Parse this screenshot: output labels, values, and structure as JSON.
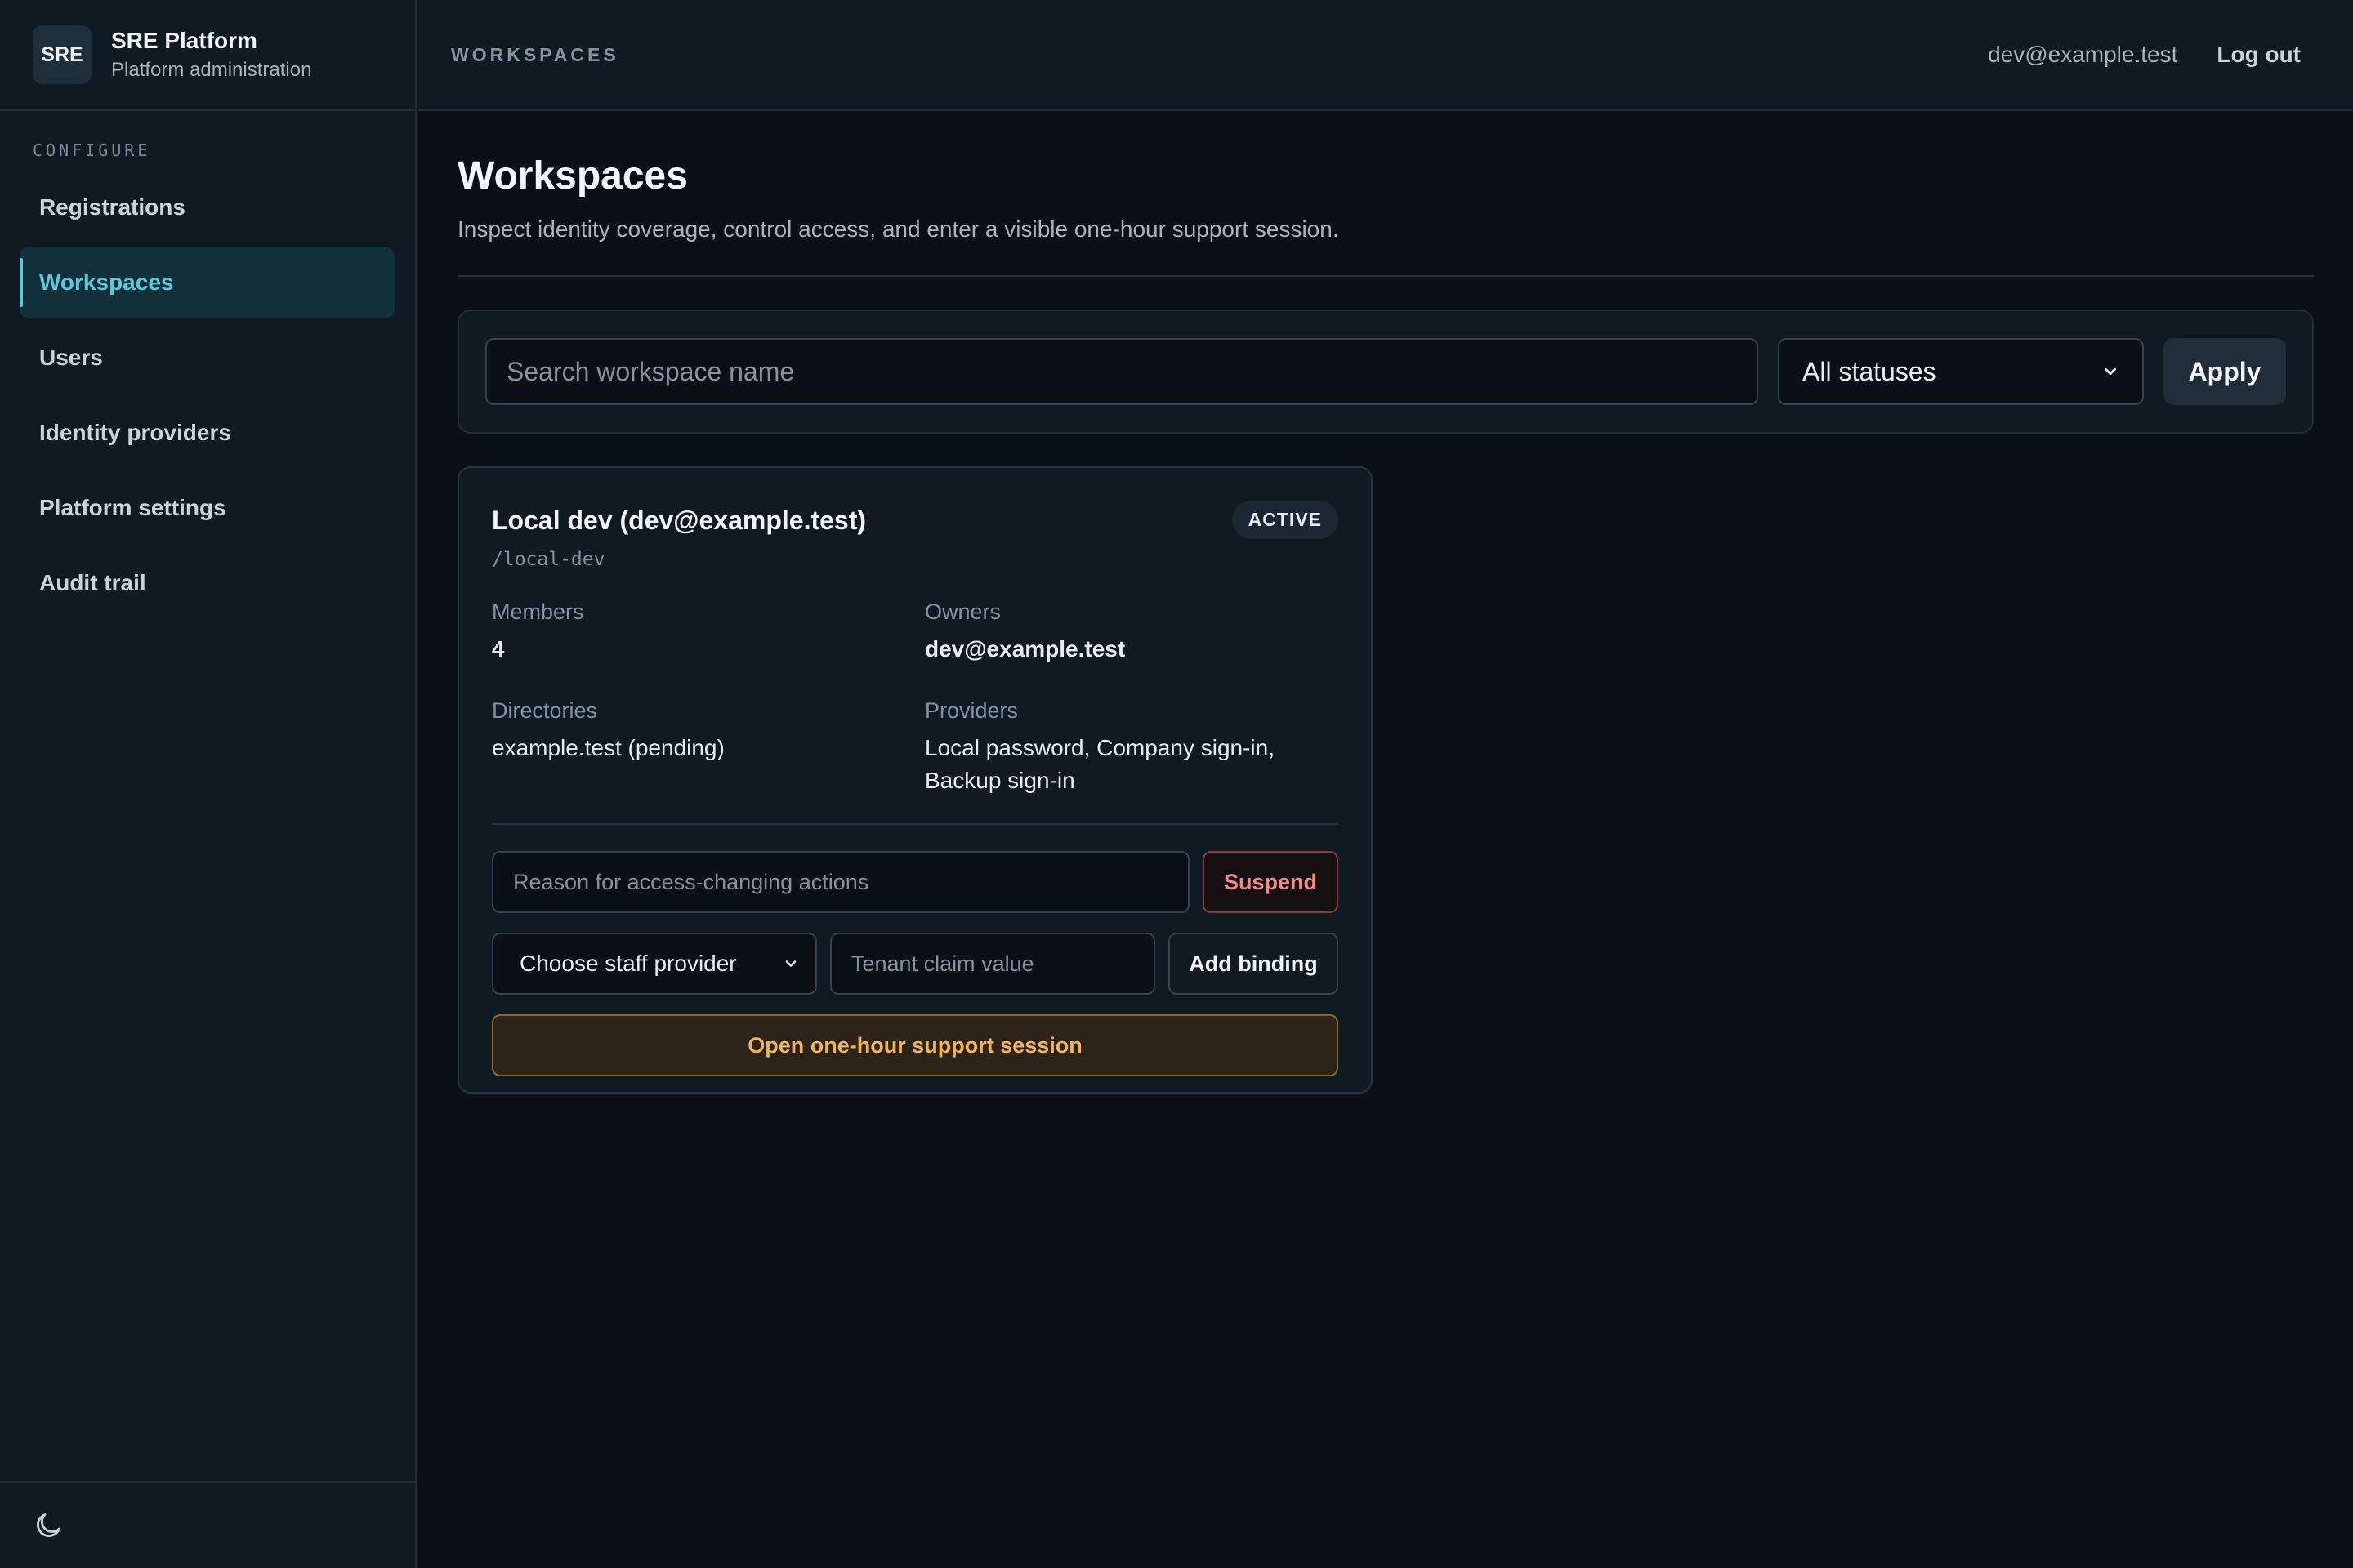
{
  "brand": {
    "logo": "SRE",
    "title": "SRE Platform",
    "subtitle": "Platform administration"
  },
  "sidebar": {
    "section": "CONFIGURE",
    "items": [
      {
        "label": "Registrations",
        "active": false
      },
      {
        "label": "Workspaces",
        "active": true
      },
      {
        "label": "Users",
        "active": false
      },
      {
        "label": "Identity providers",
        "active": false
      },
      {
        "label": "Platform settings",
        "active": false
      },
      {
        "label": "Audit trail",
        "active": false
      }
    ],
    "theme_icon": "moon-icon"
  },
  "topbar": {
    "breadcrumb": "WORKSPACES",
    "email": "dev@example.test",
    "logout": "Log out"
  },
  "page": {
    "title": "Workspaces",
    "subtitle": "Inspect identity coverage, control access, and enter a visible one-hour support session."
  },
  "filters": {
    "search_placeholder": "Search workspace name",
    "status_selected": "All statuses",
    "apply_label": "Apply"
  },
  "workspace": {
    "name": "Local dev (dev@example.test)",
    "status": "ACTIVE",
    "slug": "/local-dev",
    "members_label": "Members",
    "members_value": "4",
    "owners_label": "Owners",
    "owners_value": "dev@example.test",
    "directories_label": "Directories",
    "directories_value": "example.test (pending)",
    "providers_label": "Providers",
    "providers_value": "Local password, Company sign-in, Backup sign-in",
    "reason_placeholder": "Reason for access-changing actions",
    "suspend_label": "Suspend",
    "provider_select": "Choose staff provider",
    "tenant_placeholder": "Tenant claim value",
    "add_binding_label": "Add binding",
    "support_label": "Open one-hour support session"
  },
  "colors": {
    "accent": "#5fc8dc",
    "danger": "#f08c8c",
    "warning": "#f0b45c",
    "background": "#0a1016"
  }
}
